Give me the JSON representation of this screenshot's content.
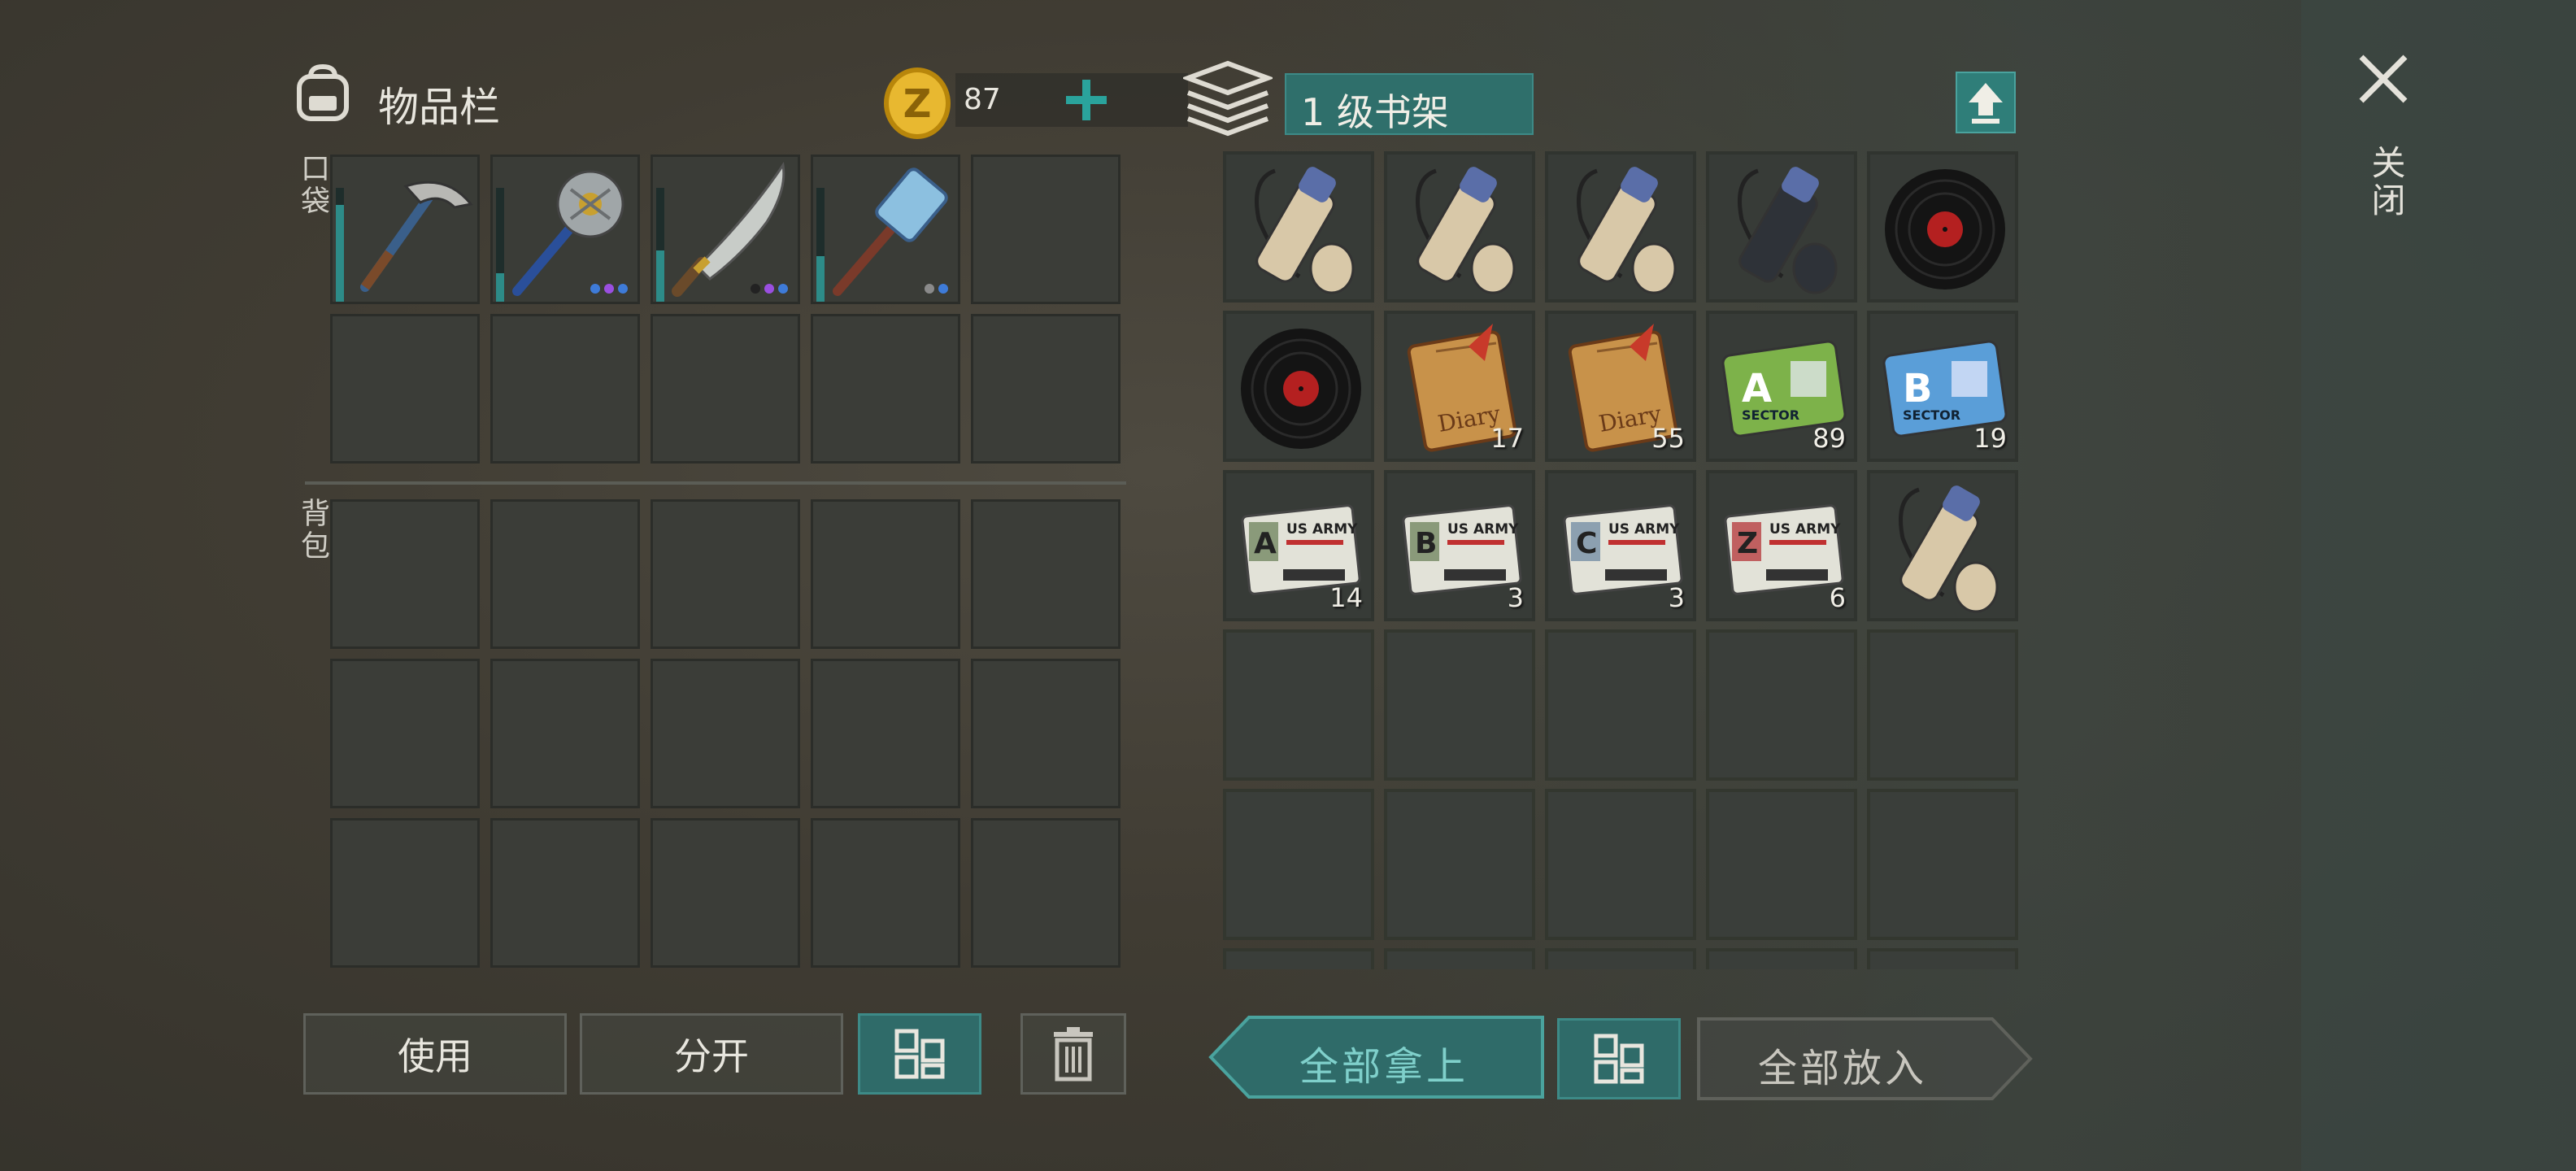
{
  "inventory": {
    "title": "物品栏",
    "coins": "87",
    "pocket_label": "口袋",
    "backpack_label": "背包",
    "pocket_items": [
      {
        "icon": "pickaxe-icon",
        "durability": 0.85,
        "dots": []
      },
      {
        "icon": "saw-club-icon",
        "durability": 0.25,
        "dots": [
          "#3e7bd8",
          "#9a4fe0",
          "#3e7bd8"
        ]
      },
      {
        "icon": "machete-icon",
        "durability": 0.45,
        "dots": [
          "#222222",
          "#9a4fe0",
          "#3e7bd8"
        ]
      },
      {
        "icon": "sledgehammer-icon",
        "durability": 0.4,
        "dots": [
          "#8a8a8a",
          "#3e7bd8"
        ]
      }
    ]
  },
  "container": {
    "title": "1 级书架",
    "items": [
      {
        "icon": "scroll-tube-icon",
        "count": ""
      },
      {
        "icon": "scroll-tube-icon",
        "count": ""
      },
      {
        "icon": "scroll-tube-icon",
        "count": ""
      },
      {
        "icon": "dark-scroll-tube-icon",
        "count": ""
      },
      {
        "icon": "vinyl-record-icon",
        "count": ""
      },
      {
        "icon": "vinyl-record-icon",
        "count": ""
      },
      {
        "icon": "diary-icon",
        "count": "17",
        "label": "Diary"
      },
      {
        "icon": "diary-icon",
        "count": "55",
        "label": "Diary"
      },
      {
        "icon": "sector-a-card-icon",
        "count": "89",
        "letter": "A",
        "label": "SECTOR",
        "color": "#7db24a"
      },
      {
        "icon": "sector-b-card-icon",
        "count": "19",
        "letter": "B",
        "label": "SECTOR",
        "color": "#5a9ed8"
      },
      {
        "icon": "army-card-a-icon",
        "count": "14",
        "letter": "A",
        "label": "US ARMY",
        "color": "#8a9a7a"
      },
      {
        "icon": "army-card-b-icon",
        "count": "3",
        "letter": "B",
        "label": "US ARMY",
        "color": "#8a9a7a"
      },
      {
        "icon": "army-card-c-icon",
        "count": "3",
        "letter": "C",
        "label": "US ARMY",
        "color": "#8ca0b0"
      },
      {
        "icon": "army-card-z-icon",
        "count": "6",
        "letter": "Z",
        "label": "US ARMY",
        "color": "#c06060"
      },
      {
        "icon": "scroll-tube-icon",
        "count": ""
      }
    ]
  },
  "buttons": {
    "use": "使用",
    "split": "分开",
    "take_all": "全部拿上",
    "put_all": "全部放入"
  },
  "close_label": "关闭",
  "colors": {
    "accent": "#2f6b69",
    "durability": "#2d8b88"
  }
}
